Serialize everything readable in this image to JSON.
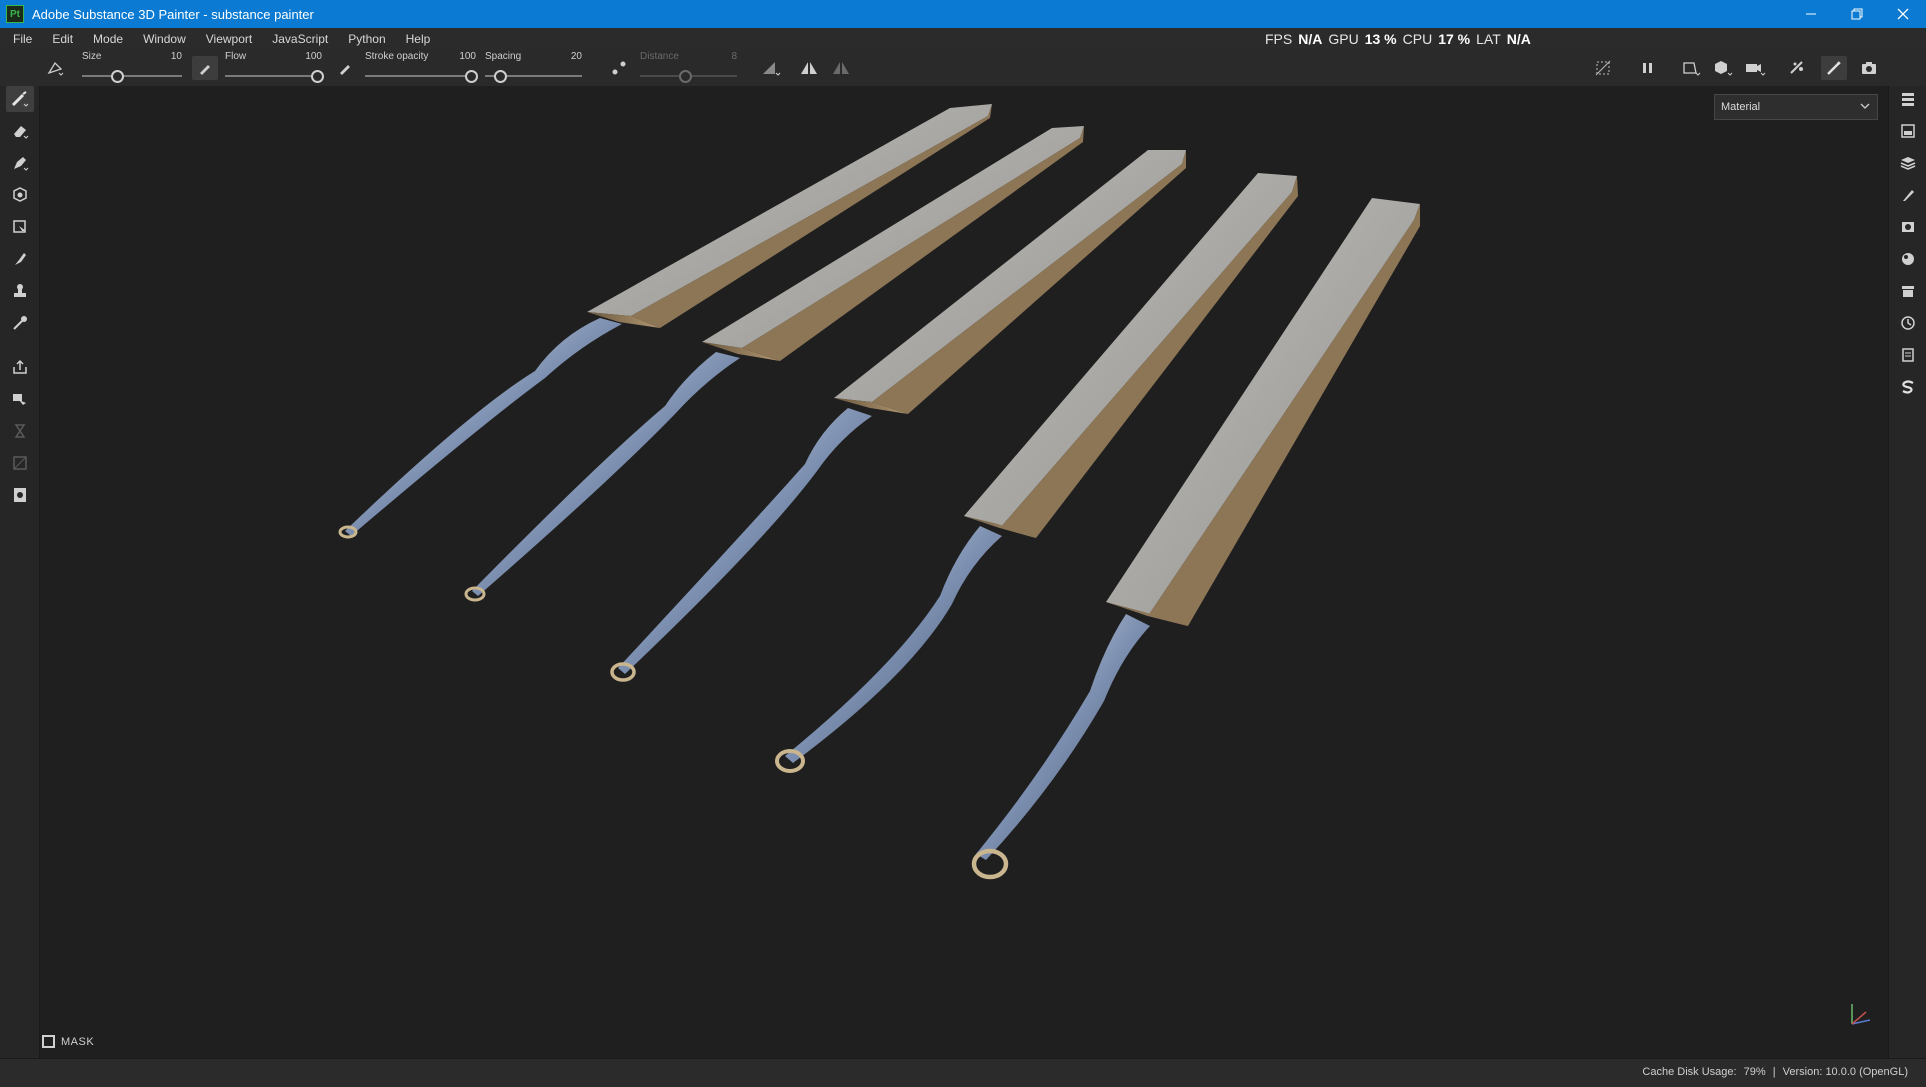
{
  "window": {
    "title": "Adobe Substance 3D Painter - substance painter",
    "app_badge": "Pt"
  },
  "menu": [
    "File",
    "Edit",
    "Mode",
    "Window",
    "Viewport",
    "JavaScript",
    "Python",
    "Help"
  ],
  "perf": {
    "fps_label": "FPS",
    "fps_value": "N/A",
    "gpu_label": "GPU",
    "gpu_value": "13 %",
    "cpu_label": "CPU",
    "cpu_value": "17 %",
    "lat_label": "LAT",
    "lat_value": "N/A"
  },
  "toolbar": {
    "size": {
      "label": "Size",
      "value": "10",
      "fraction": 0.33
    },
    "flow": {
      "label": "Flow",
      "value": "100",
      "fraction": 1.0
    },
    "stroke_opacity": {
      "label": "Stroke opacity",
      "value": "100",
      "fraction": 1.0
    },
    "spacing": {
      "label": "Spacing",
      "value": "20",
      "fraction": 0.1
    },
    "distance": {
      "label": "Distance",
      "value": "8",
      "fraction": 0.45
    }
  },
  "viewport": {
    "material_select": "Material",
    "mask_label": "MASK",
    "scene_object_count": 5
  },
  "status": {
    "cache_label": "Cache Disk Usage:",
    "cache_value": "79%",
    "separator": "|",
    "version": "Version: 10.0.0 (OpenGL)"
  },
  "colors": {
    "titlebar": "#0a7ad2",
    "background": "#1f1f1f",
    "panel": "#2a2a2a",
    "metal_light": "#d9d7d2",
    "metal_edge": "#a08660"
  }
}
